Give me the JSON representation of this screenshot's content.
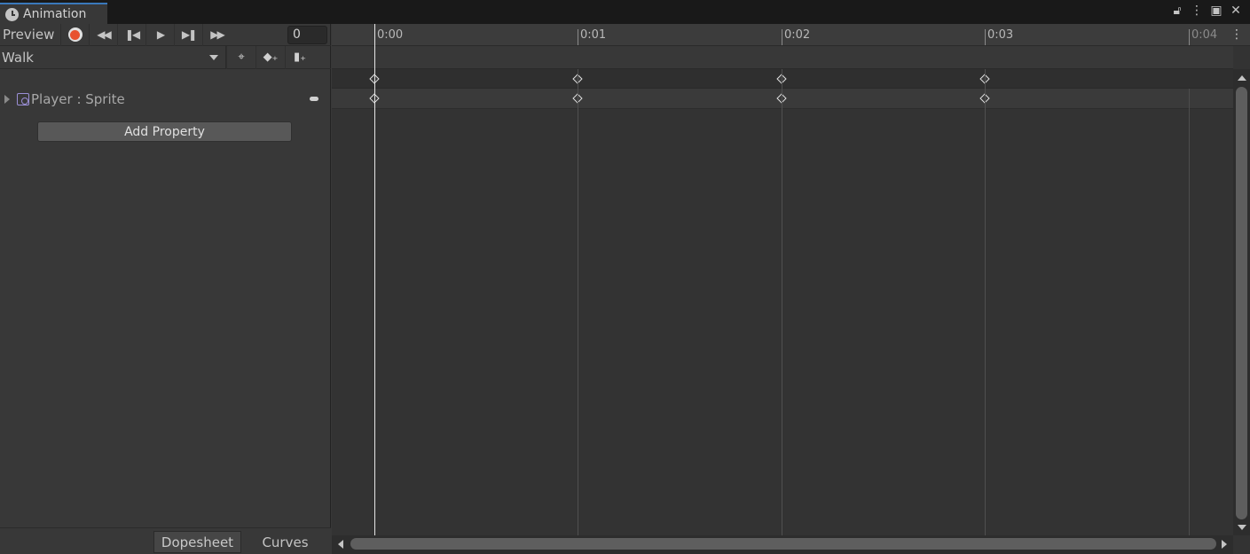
{
  "window": {
    "tab_title": "Animation",
    "controls": [
      "lock-icon",
      "menu-icon",
      "maximize-icon",
      "close-icon"
    ]
  },
  "toolbar": {
    "preview_label": "Preview",
    "current_frame": "0",
    "buttons": [
      "record-icon",
      "first-key-icon",
      "prev-key-icon",
      "play-icon",
      "next-key-icon",
      "last-key-icon"
    ]
  },
  "clip": {
    "selected": "Walk",
    "tools": [
      "filter-by-selection-icon",
      "add-keyframe-icon",
      "add-event-icon"
    ]
  },
  "properties": [
    {
      "label": "Player : Sprite",
      "icon": "sprite-renderer-icon"
    }
  ],
  "add_property_label": "Add Property",
  "bottom_tabs": {
    "dopesheet": "Dopesheet",
    "curves": "Curves",
    "active": "Dopesheet"
  },
  "timeline": {
    "ticks": [
      "0:00",
      "0:01",
      "0:02",
      "0:03",
      "0:04"
    ],
    "playhead_frame": 0,
    "keyframes": [
      0,
      1,
      2,
      3
    ],
    "clip_end": 4
  },
  "colors": {
    "accent": "#3a79bb",
    "record": "#e8522f",
    "sprite_icon": "#9b8fd6"
  }
}
